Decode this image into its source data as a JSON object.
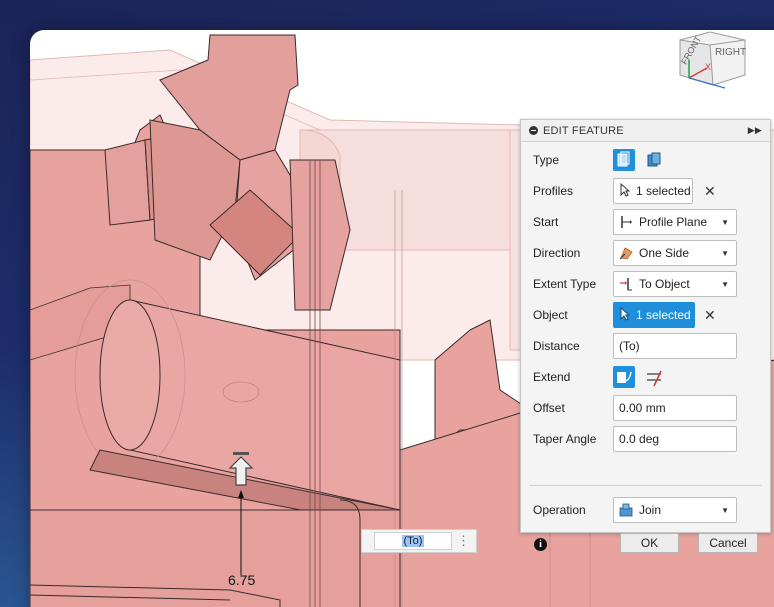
{
  "viewcube": {
    "faces": [
      "FRONT",
      "RIGHT"
    ],
    "axis_label": "X"
  },
  "edit_feature": {
    "title": "EDIT FEATURE",
    "type_label": "Type",
    "profiles": {
      "label": "Profiles",
      "value": "1 selected"
    },
    "start": {
      "label": "Start",
      "value": "Profile Plane"
    },
    "direction": {
      "label": "Direction",
      "value": "One Side"
    },
    "extent_type": {
      "label": "Extent Type",
      "value": "To Object"
    },
    "object": {
      "label": "Object",
      "value": "1 selected"
    },
    "distance": {
      "label": "Distance",
      "value": "(To)"
    },
    "extend_label": "Extend",
    "offset": {
      "label": "Offset",
      "value": "0.00 mm"
    },
    "taper_angle": {
      "label": "Taper Angle",
      "value": "0.0 deg"
    },
    "operation": {
      "label": "Operation",
      "value": "Join"
    },
    "ok_label": "OK",
    "cancel_label": "Cancel",
    "close_glyph": "✕"
  },
  "inline_input": {
    "value": "(To)"
  },
  "dimension": {
    "value": "6.75"
  },
  "colors": {
    "accent": "#1f8fdb",
    "model_fill": "#e8a39f",
    "model_ghost": "#f6dedc",
    "model_edge": "#3a2a2a"
  },
  "icons": {
    "type_solid": "extrude-solid-icon",
    "type_thin": "extrude-thin-icon",
    "select": "cursor-arrow-icon",
    "start": "profile-plane-icon",
    "direction": "one-side-icon",
    "extent": "to-object-icon",
    "extend_min": "extend-minimum-icon",
    "extend_all": "extend-all-icon",
    "operation": "join-icon",
    "info": "info-icon"
  }
}
